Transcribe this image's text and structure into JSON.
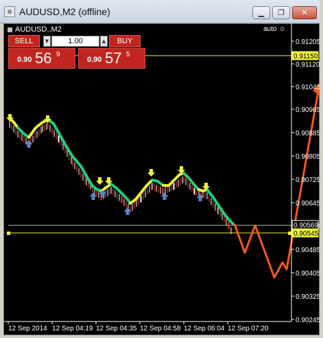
{
  "window": {
    "title": "AUDUSD,M2 (offline)",
    "icon": "chart-window-icon",
    "controls": [
      "minimize-icon",
      "restore-icon",
      "close-icon"
    ]
  },
  "chart": {
    "symbol_label": "AUDUSD.,M2",
    "auto_label": "auto",
    "background": "#000000",
    "grid_color": "#ffffff",
    "up_line_color": "#1fcf7a",
    "down_line_color": "#f2f23c",
    "level_line_color": "#f2f23c",
    "projection_color": "#f4591e"
  },
  "trade_panel": {
    "sell_label": "SELL",
    "buy_label": "BUY",
    "lot_value": "1.00",
    "sell_price_prefix": "0.90",
    "sell_price_big": "56",
    "sell_price_sup": "9",
    "buy_price_prefix": "0.90",
    "buy_price_big": "57",
    "buy_price_sup": "5"
  },
  "price_axis": {
    "ticks": [
      "0.91205",
      "0.91120",
      "0.91045",
      "0.90965",
      "0.90885",
      "0.90805",
      "0.90725",
      "0.90645",
      "0.90565",
      "0.90485",
      "0.90405",
      "0.90325",
      "0.90245"
    ],
    "highlighted": [
      {
        "label": "0.91150",
        "bg": "#f2f23c"
      },
      {
        "label": "0.90569",
        "bg": "#000000"
      },
      {
        "label": "0.90545",
        "bg": "#f2f23c"
      }
    ]
  },
  "time_axis": {
    "ticks": [
      "12 Sep 2014",
      "12 Sep 04:19",
      "12 Sep 04:35",
      "12 Sep 04:58",
      "12 Sep 06:04",
      "12 Sep 07:20"
    ]
  }
}
